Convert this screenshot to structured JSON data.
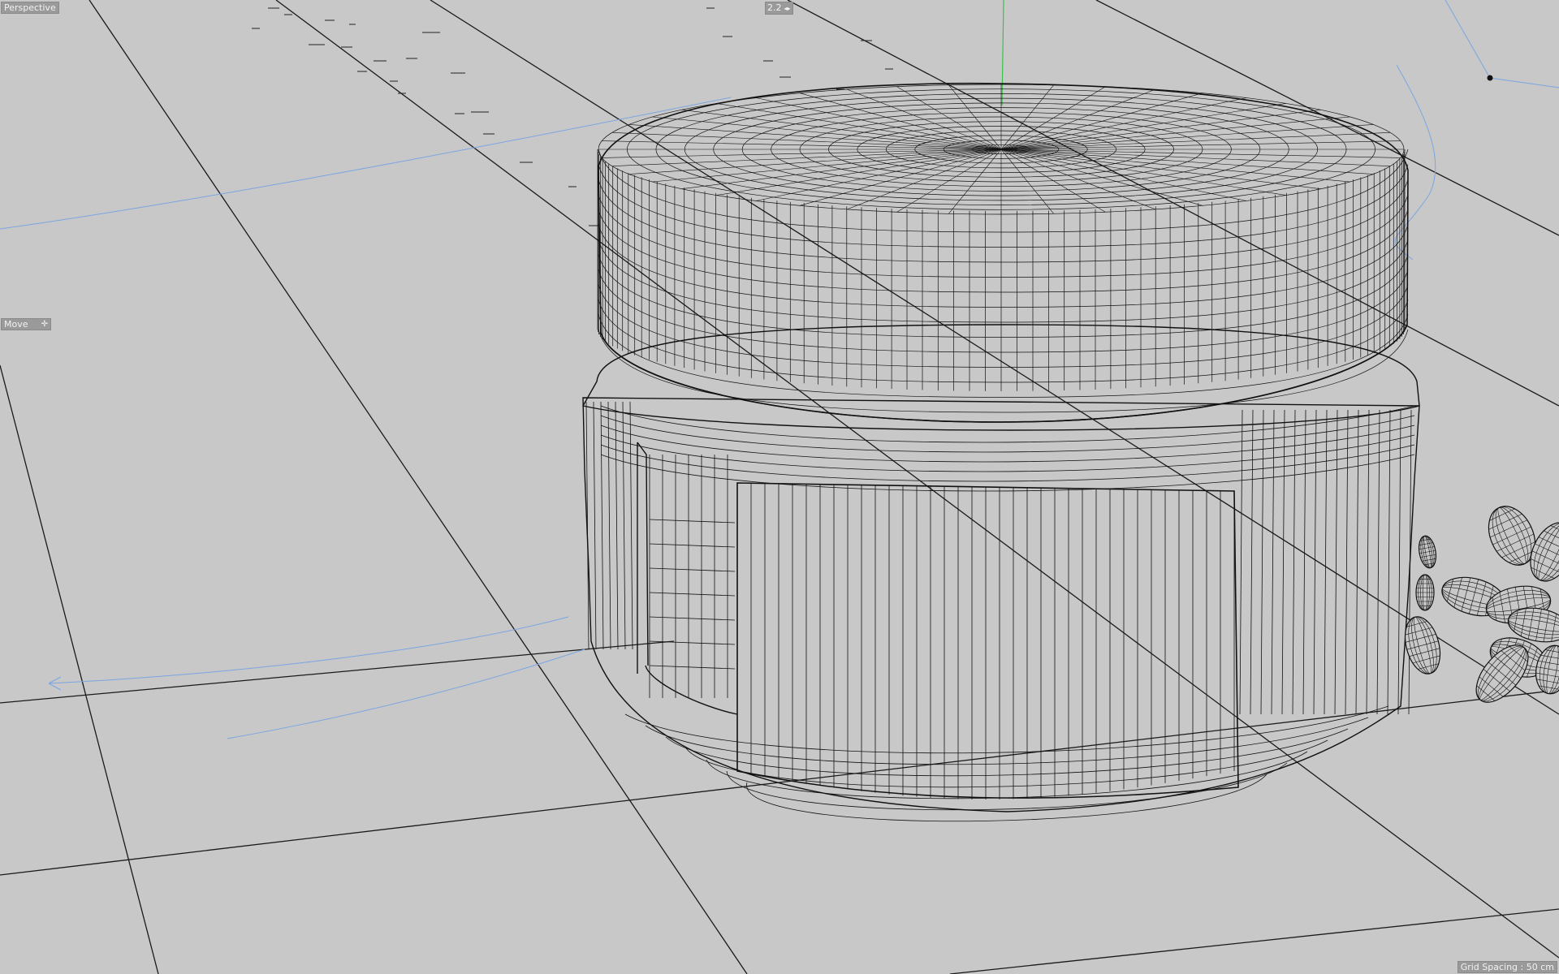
{
  "viewport": {
    "camera_name": "Perspective",
    "badge_text": "2.2",
    "active_tool": "Move",
    "grid_spacing": "Grid Spacing : 50 cm"
  },
  "colors": {
    "background": "#c8c8c8",
    "wire": "#111111",
    "grid_line": "#1a1a1a",
    "spline": "#7aa6e0",
    "y_axis": "#3ac24a",
    "hud_bg": "#9a9a9a"
  },
  "objects": [
    "jar-body",
    "jar-lid",
    "pill-cluster"
  ]
}
